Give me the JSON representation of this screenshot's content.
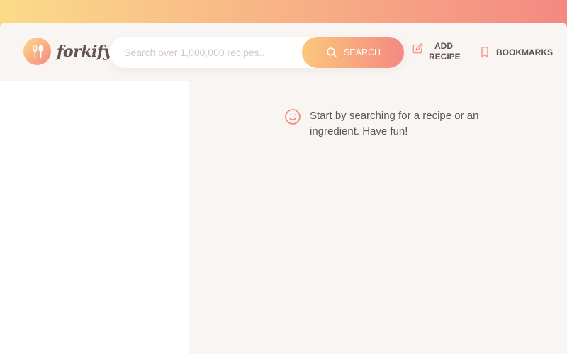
{
  "colors": {
    "gradient_start": "#fbdb89",
    "gradient_end": "#f48982",
    "primary_text": "#615551",
    "icon_accent": "#f38e82",
    "panel_bg": "#f9f5f3"
  },
  "logo": {
    "text": "forkify",
    "icon": "fork-and-spoon-icon"
  },
  "search": {
    "placeholder": "Search over 1,000,000 recipes...",
    "value": "",
    "button_label": "Search",
    "button_icon": "search-icon"
  },
  "nav": {
    "add_recipe": {
      "line1": "Add",
      "line2": "Recipe",
      "icon": "edit-icon"
    },
    "bookmarks": {
      "label": "Bookmarks",
      "icon": "bookmark-icon"
    }
  },
  "recipe_panel": {
    "message_icon": "smile-icon",
    "message": "Start by searching for a recipe or an ingredient. Have fun!"
  }
}
